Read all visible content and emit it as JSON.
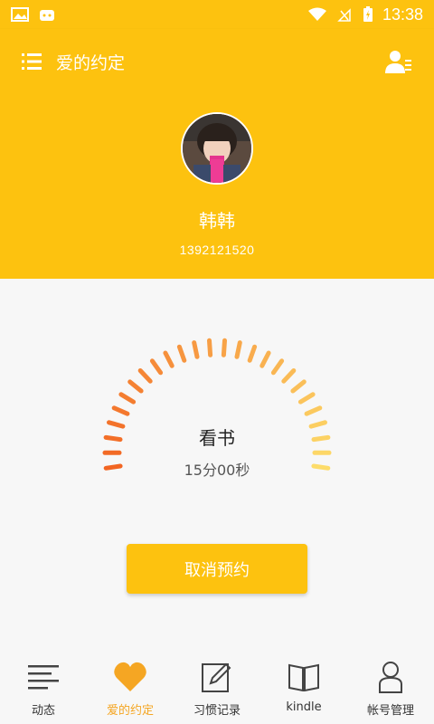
{
  "status_bar": {
    "time": "13:38"
  },
  "app_bar": {
    "title": "爱的约定"
  },
  "profile": {
    "name": "韩韩",
    "phone": "1392121520"
  },
  "appointment": {
    "activity": "看书",
    "duration": "15分00秒"
  },
  "cancel_button": {
    "label": "取消预约"
  },
  "tabs": [
    {
      "label": "动态",
      "icon": "list-icon",
      "active": false
    },
    {
      "label": "爱的约定",
      "icon": "heart-icon",
      "active": true
    },
    {
      "label": "习惯记录",
      "icon": "edit-icon",
      "active": false
    },
    {
      "label": "kindle",
      "icon": "book-icon",
      "active": false
    },
    {
      "label": "帐号管理",
      "icon": "person-icon",
      "active": false
    }
  ],
  "colors": {
    "primary": "#fdc20f",
    "active_tab": "#f5a623",
    "gauge_start": "#f26522",
    "gauge_end": "#fddc6a"
  }
}
